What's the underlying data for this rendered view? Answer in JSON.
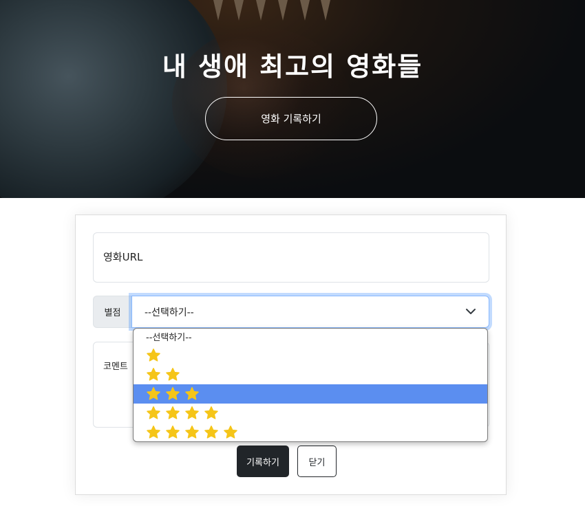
{
  "hero": {
    "title": "내 생애 최고의 영화들",
    "button_label": "영화 기록하기"
  },
  "form": {
    "url_placeholder": "영화URL",
    "rating_label": "별점",
    "rating_selected": "--선택하기--",
    "comment_placeholder": "코멘트",
    "submit_label": "기록하기",
    "close_label": "닫기"
  },
  "dropdown": {
    "options": [
      {
        "label": "--선택하기--",
        "stars": 0
      },
      {
        "label": "",
        "stars": 1
      },
      {
        "label": "",
        "stars": 2
      },
      {
        "label": "",
        "stars": 3,
        "highlighted": true
      },
      {
        "label": "",
        "stars": 4
      },
      {
        "label": "",
        "stars": 5
      }
    ]
  },
  "colors": {
    "star": "#f5c518",
    "highlight": "#5b8ef0",
    "dark_button": "#212529",
    "focus_ring": "#86b7fe"
  },
  "icons": {
    "select_chevron": "chevron-down-icon",
    "rating_star": "star-icon"
  }
}
